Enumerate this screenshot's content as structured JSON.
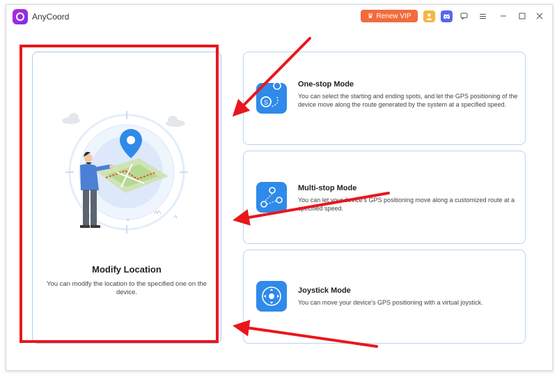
{
  "app": {
    "title": "AnyCoord"
  },
  "titlebar": {
    "renew_label": "Renew VIP",
    "icons": [
      "crown-icon",
      "user-avatar-icon",
      "discord-icon",
      "feedback-icon",
      "menu-icon",
      "minimize-icon",
      "maximize-icon",
      "close-icon"
    ]
  },
  "modes": {
    "modify": {
      "title": "Modify Location",
      "desc": "You can modify the location to the specified one on the device."
    },
    "onestop": {
      "title": "One-stop Mode",
      "desc": "You can select the starting and ending spots, and let the GPS positioning of the device move along the route generated by the system at a specified speed."
    },
    "multistop": {
      "title": "Multi-stop Mode",
      "desc": "You can let your device's GPS positioning move along a customized route at a specified speed."
    },
    "joystick": {
      "title": "Joystick Mode",
      "desc": "You can move your device's GPS positioning with a virtual joystick."
    }
  },
  "colors": {
    "accent": "#2f8ae9",
    "renew": "#f36b3d",
    "annotation": "#e8171c",
    "card_border": "#b9d3f1"
  }
}
